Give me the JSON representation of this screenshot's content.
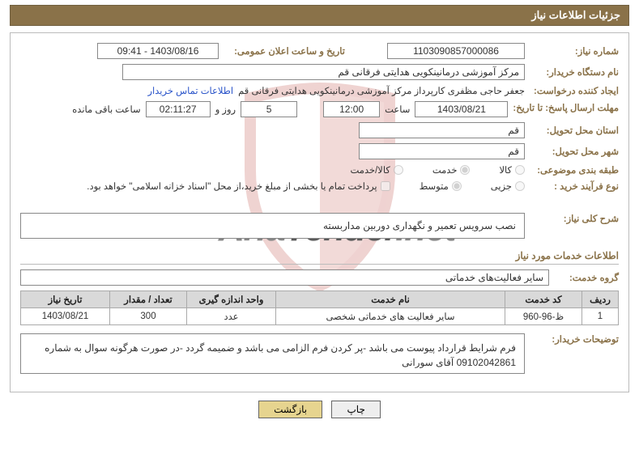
{
  "header": {
    "title": "جزئیات اطلاعات نیاز"
  },
  "needNo": {
    "label": "شماره نیاز:",
    "value": "1103090857000086"
  },
  "announce": {
    "label": "تاریخ و ساعت اعلان عمومی:",
    "value": "1403/08/16 - 09:41"
  },
  "buyerOrg": {
    "label": "نام دستگاه خریدار:",
    "value": "مرکز آموزشی درمانینکویی هدایتی فرقانی قم"
  },
  "requester": {
    "label": "ایجاد کننده درخواست:",
    "value": "جعفر حاجی مظفری کارپرداز مرکز آموزشی درمانینکویی هدایتی فرقانی قم"
  },
  "contactLink": "اطلاعات تماس خریدار",
  "deadline": {
    "label": "مهلت ارسال پاسخ: تا تاریخ:",
    "date": "1403/08/21",
    "hourLabel": "ساعت",
    "hour": "12:00",
    "daysLabel": "روز و",
    "days": "5",
    "remainLabel": "ساعت باقی مانده",
    "remain": "02:11:27"
  },
  "province": {
    "label": "استان محل تحویل:",
    "value": "قم"
  },
  "city": {
    "label": "شهر محل تحویل:",
    "value": "قم"
  },
  "category": {
    "label": "طبقه بندی موضوعی:",
    "opts": {
      "kala": "کالا",
      "khadmat": "خدمت",
      "kalaKhadmat": "کالا/خدمت"
    }
  },
  "processType": {
    "label": "نوع فرآیند خرید :",
    "opts": {
      "jozi": "جزیی",
      "motavaset": "متوسط"
    },
    "note": "پرداخت تمام یا بخشی از مبلغ خرید،از محل \"اسناد خزانه اسلامی\" خواهد بود."
  },
  "needDesc": {
    "label": "شرح کلی نیاز:",
    "value": "نصب سرویس تعمیر و نگهداری دوربین مداربسته"
  },
  "servicesTitle": "اطلاعات خدمات مورد نیاز",
  "serviceGroup": {
    "label": "گروه خدمت:",
    "value": "سایر فعالیت‌های خدماتی"
  },
  "table": {
    "headers": {
      "row": "ردیف",
      "code": "کد خدمت",
      "name": "نام خدمت",
      "unit": "واحد اندازه گیری",
      "qty": "تعداد / مقدار",
      "needDate": "تاریخ نیاز"
    },
    "rows": [
      {
        "row": "1",
        "code": "ظ-96-960",
        "name": "سایر فعالیت های خدماتی شخصی",
        "unit": "عدد",
        "qty": "300",
        "needDate": "1403/08/21"
      }
    ]
  },
  "buyerNote": {
    "label": "توضیحات خریدار:",
    "value": "فرم شرایط قرارداد پیوست می باشد -پر کردن فرم الزامی می باشد و ضمیمه گردد -در صورت هرگونه سوال به شماره 09102042861 آقای سورانی"
  },
  "buttons": {
    "print": "چاپ",
    "back": "بازگشت"
  }
}
